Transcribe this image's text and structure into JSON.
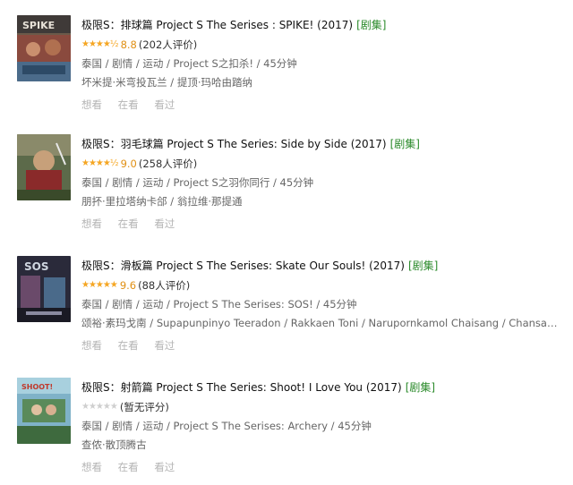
{
  "items": [
    {
      "title": "极限S：排球篇 Project S The Serises : SPIKE! (2017)",
      "badge": "[剧集]",
      "stars": "★★★★½",
      "score": "8.8",
      "count": "(202人评价)",
      "meta": "泰国 / 剧情 / 运动 / Project S之扣杀! / 45分钟",
      "people": "坏米提·米弯投瓦兰 / 提顶·玛哈由踏纳",
      "actions": [
        "想看",
        "在看",
        "看过"
      ],
      "rated": true
    },
    {
      "title": "极限S：羽毛球篇 Project S The Series: Side by Side (2017)",
      "badge": "[剧集]",
      "stars": "★★★★½",
      "score": "9.0",
      "count": "(258人评价)",
      "meta": "泰国 / 剧情 / 运动 / Project S之羽你同行 / 45分钟",
      "people": "朋抔·里拉塔纳卡郃 / 翁拉维·那提通",
      "actions": [
        "想看",
        "在看",
        "看过"
      ],
      "rated": true
    },
    {
      "title": "极限S：滑板篇 Project S The Serises: Skate Our Souls! (2017)",
      "badge": "[剧集]",
      "stars": "★★★★★",
      "score": "9.6",
      "count": "(88人评价)",
      "meta": "泰国 / 剧情 / 运动 / Project S The Serises: SOS! / 45分钟",
      "people": "颂裕·素玛戈南 / Supapunpinyo Teeradon / Rakkaen Toni / Narupornkamol Chaisang / Chansangav...",
      "actions": [
        "想看",
        "在看",
        "看过"
      ],
      "rated": true
    },
    {
      "title": "极限S：射箭篇 Project S The Series: Shoot! I Love You (2017)",
      "badge": "[剧集]",
      "stars": "★★★★★",
      "score": "",
      "count": "(暂无评分)",
      "meta": "泰国 / 剧情 / 运动 / Project S The Serises: Archery / 45分钟",
      "people": "查侬·散顶腾古",
      "actions": [
        "想看",
        "在看",
        "看过"
      ],
      "rated": false
    }
  ],
  "colors": {
    "star": "#f5a623",
    "score": "#e09015",
    "badge": "#2a8a2a",
    "meta": "#666666",
    "action": "#b5b5b5"
  },
  "posters": [
    "spike-poster",
    "side-by-side-poster",
    "sos-poster",
    "shoot-poster"
  ]
}
